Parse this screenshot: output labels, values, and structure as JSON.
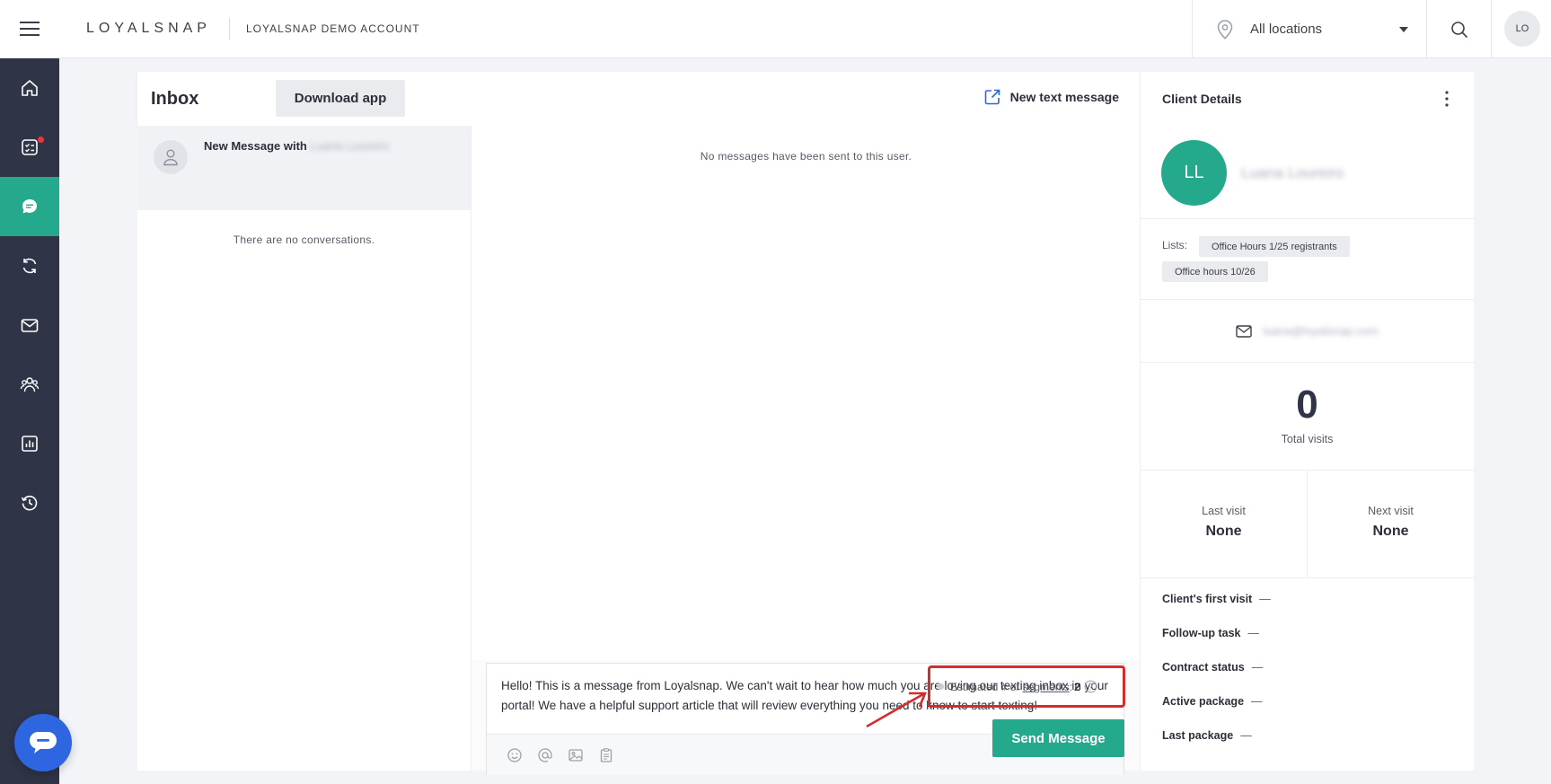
{
  "topbar": {
    "brand": "LOYALSNAP",
    "account": "LOYALSNAP DEMO ACCOUNT",
    "location": "All locations",
    "user_initials": "LO"
  },
  "sidebar": {
    "items": [
      {
        "icon": "home-icon"
      },
      {
        "icon": "checklist-icon",
        "notification": true
      },
      {
        "icon": "chat-icon",
        "active": true
      },
      {
        "icon": "refresh-icon"
      },
      {
        "icon": "mail-icon"
      },
      {
        "icon": "clients-icon"
      },
      {
        "icon": "reports-icon"
      },
      {
        "icon": "history-icon"
      }
    ],
    "accent": "#25a98d",
    "background": "#2f3447"
  },
  "inbox": {
    "title": "Inbox",
    "download_label": "Download app",
    "new_text_label": "New text message"
  },
  "conversations": {
    "item": {
      "prefix": "New Message with",
      "name": "Luana Loureiro"
    },
    "empty_text": "There are no conversations."
  },
  "thread": {
    "empty_text": "No messages have been sent to this user.",
    "composer_text": "Hello! This is a message from Loyalsnap. We can't wait to hear how much you are loving our texting inbox in your portal! We have a helpful support article that will review everything you need to know to start texting!",
    "segments_prefix": "Estimated # of",
    "segments_link": "segments",
    "segments_sep": ":",
    "segments_count": "2",
    "send_label": "Send Message"
  },
  "client": {
    "header": "Client Details",
    "initials": "LL",
    "name": "Luana Loureiro",
    "lists_label": "Lists:",
    "lists": [
      "Office Hours 1/25 registrants",
      "Office hours 10/26"
    ],
    "email": "luana@loyalsnap.com",
    "total_visits": "0",
    "total_visits_label": "Total visits",
    "last_visit_label": "Last visit",
    "last_visit": "None",
    "next_visit_label": "Next visit",
    "next_visit": "None",
    "facts": [
      {
        "label": "Client's first visit",
        "value": "—"
      },
      {
        "label": "Follow-up task",
        "value": "—"
      },
      {
        "label": "Contract status",
        "value": "—"
      },
      {
        "label": "Active package",
        "value": "—"
      },
      {
        "label": "Last package",
        "value": "—"
      }
    ]
  }
}
